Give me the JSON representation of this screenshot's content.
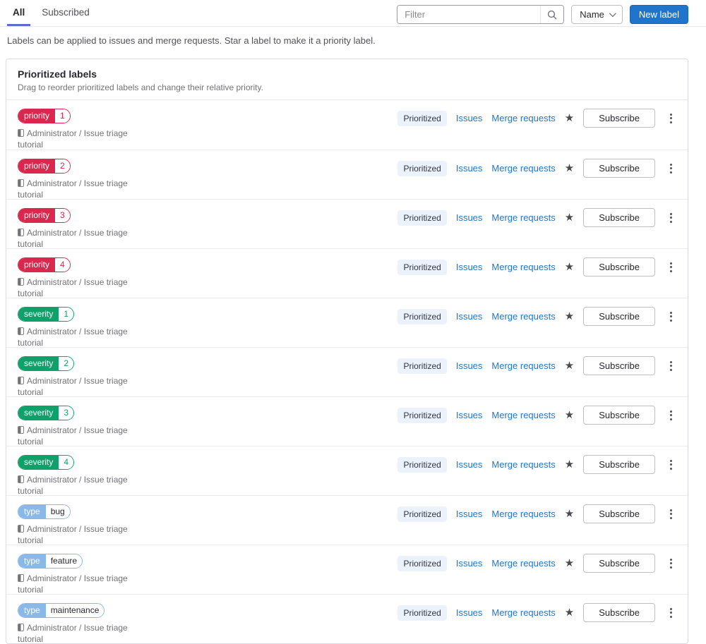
{
  "tabs": [
    {
      "label": "All",
      "active": true
    },
    {
      "label": "Subscribed",
      "active": false
    }
  ],
  "toolbar": {
    "filter_placeholder": "Filter",
    "sort_label": "Name",
    "new_label_button": "New label"
  },
  "description": "Labels can be applied to issues and merge requests. Star a label to make it a priority label.",
  "icons": {
    "star": "★",
    "search": "magnifier",
    "chevron": "chevron-down",
    "kebab": "vertical-ellipsis",
    "project": "half-filled-rect"
  },
  "colors": {
    "accent_blue": "#1f75cb",
    "tab_underline": "#5d6cd2",
    "priority_red": "#d9274d",
    "severity_green": "#10a06a",
    "type_blue": "#8ab8e8",
    "prioritized_badge_bg": "#ecf2fc"
  },
  "card": {
    "title": "Prioritized labels",
    "subtitle": "Drag to reorder prioritized labels and change their relative priority.",
    "row_actions": {
      "prioritized_badge": "Prioritized",
      "issues_link": "Issues",
      "merge_requests_link": "Merge requests",
      "subscribe_button": "Subscribe"
    },
    "labels": [
      {
        "scope": "priority",
        "value": "1",
        "color": "#d9274d",
        "value_color": "#d9274d",
        "project": "Administrator / Issue triage tutorial"
      },
      {
        "scope": "priority",
        "value": "2",
        "color": "#d9274d",
        "value_color": "#d9274d",
        "project": "Administrator / Issue triage tutorial"
      },
      {
        "scope": "priority",
        "value": "3",
        "color": "#d9274d",
        "value_color": "#d9274d",
        "project": "Administrator / Issue triage tutorial"
      },
      {
        "scope": "priority",
        "value": "4",
        "color": "#d9274d",
        "value_color": "#d9274d",
        "project": "Administrator / Issue triage tutorial"
      },
      {
        "scope": "severity",
        "value": "1",
        "color": "#10a06a",
        "value_color": "#10a06a",
        "project": "Administrator / Issue triage tutorial"
      },
      {
        "scope": "severity",
        "value": "2",
        "color": "#10a06a",
        "value_color": "#10a06a",
        "project": "Administrator / Issue triage tutorial"
      },
      {
        "scope": "severity",
        "value": "3",
        "color": "#10a06a",
        "value_color": "#10a06a",
        "project": "Administrator / Issue triage tutorial"
      },
      {
        "scope": "severity",
        "value": "4",
        "color": "#10a06a",
        "value_color": "#10a06a",
        "project": "Administrator / Issue triage tutorial"
      },
      {
        "scope": "type",
        "value": "bug",
        "color": "#8ab8e8",
        "value_color": "#28272d",
        "project": "Administrator / Issue triage tutorial"
      },
      {
        "scope": "type",
        "value": "feature",
        "color": "#8ab8e8",
        "value_color": "#28272d",
        "project": "Administrator / Issue triage tutorial"
      },
      {
        "scope": "type",
        "value": "maintenance",
        "color": "#8ab8e8",
        "value_color": "#28272d",
        "project": "Administrator / Issue triage tutorial"
      }
    ]
  }
}
